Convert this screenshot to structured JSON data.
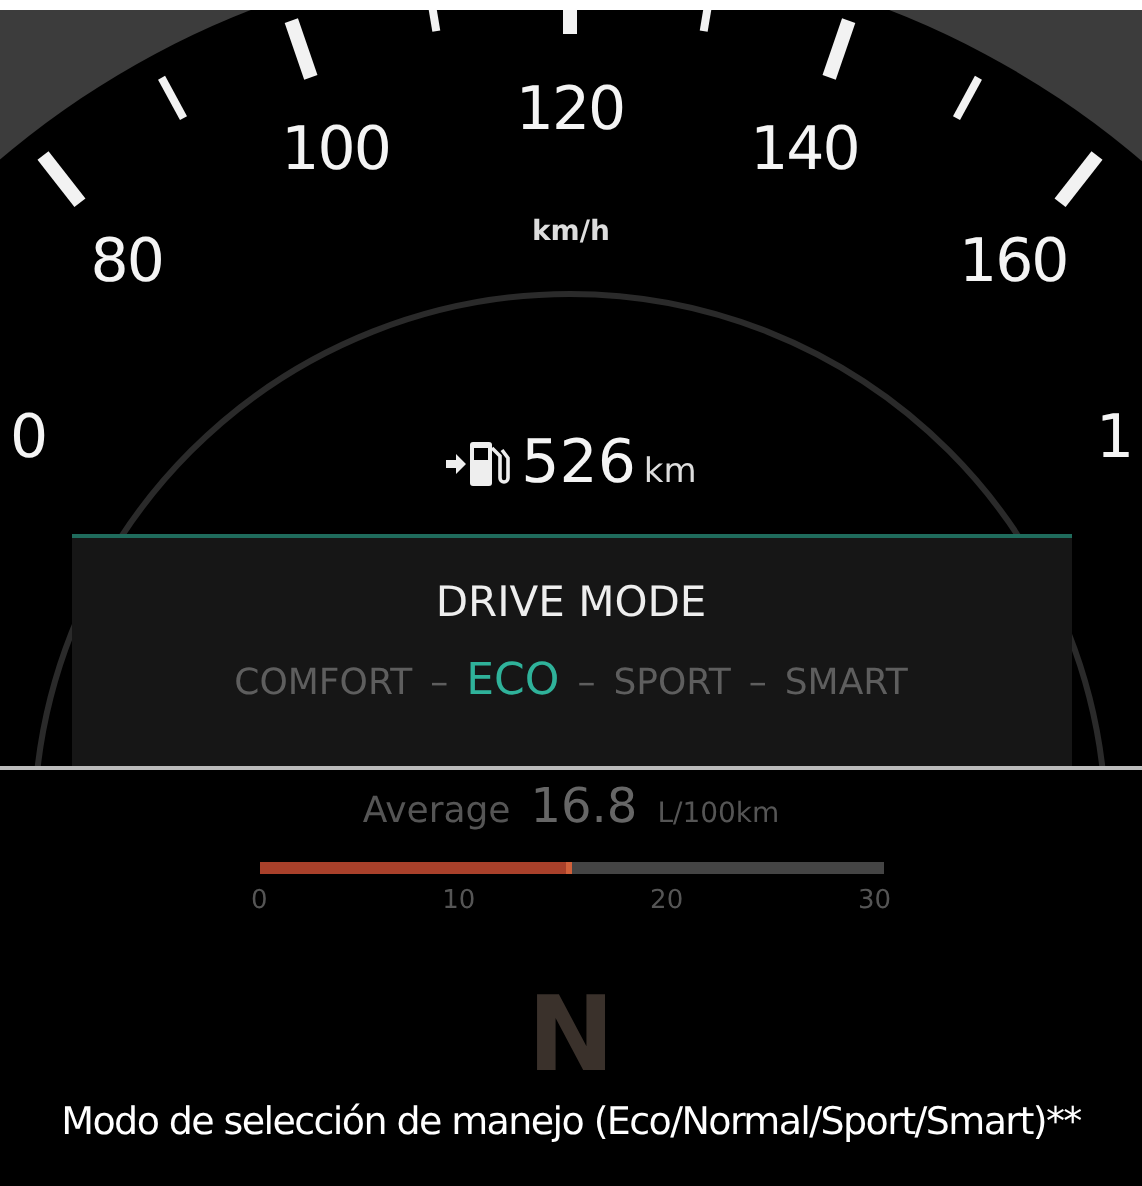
{
  "speedometer": {
    "unit": "km/h",
    "scale": [
      {
        "label": "0"
      },
      {
        "label": "80"
      },
      {
        "label": "100"
      },
      {
        "label": "120"
      },
      {
        "label": "140"
      },
      {
        "label": "160"
      },
      {
        "label": "1"
      }
    ]
  },
  "range": {
    "value": "526",
    "unit": "km"
  },
  "drive_mode": {
    "title": "DRIVE MODE",
    "modes": [
      {
        "label": "COMFORT",
        "selected": false
      },
      {
        "label": "ECO",
        "selected": true
      },
      {
        "label": "SPORT",
        "selected": false
      },
      {
        "label": "SMART",
        "selected": false
      }
    ],
    "separators": [
      "–",
      "–",
      "–"
    ]
  },
  "fuel_economy": {
    "label": "Average",
    "value": "16.8",
    "unit": "L/100km",
    "level": 0.5,
    "ticks": [
      "0",
      "10",
      "20",
      "30"
    ]
  },
  "gear": "N",
  "caption": "Modo de selección de manejo (Eco/Normal/Sport/Smart)**"
}
